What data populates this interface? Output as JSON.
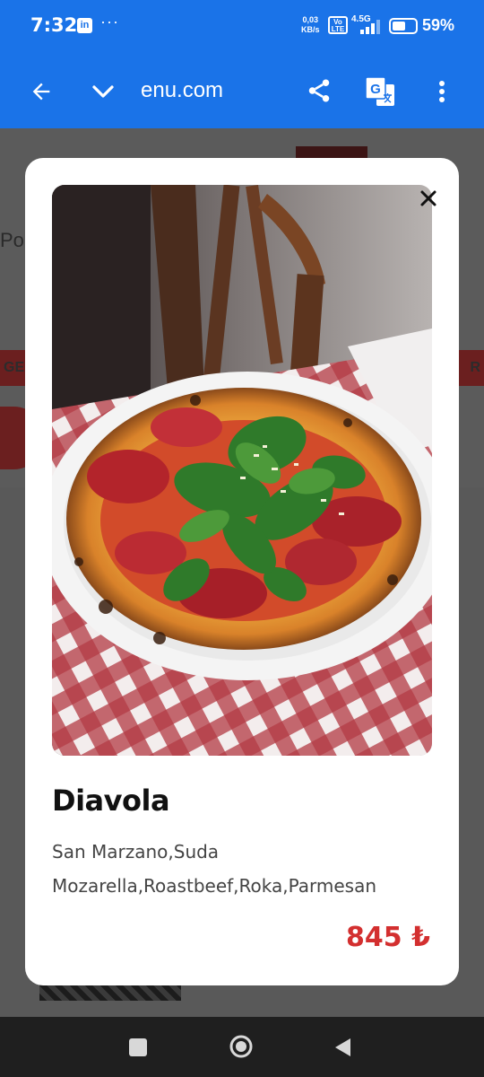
{
  "status_bar": {
    "time": "7:32",
    "linkedin_badge": "in",
    "more": "···",
    "data_rate_value": "0,03",
    "data_rate_unit": "KB/s",
    "volte_line1": "Vo",
    "volte_line2": "LTE",
    "network": "4.5G",
    "battery_percent": "59%",
    "battery_level": 0.59
  },
  "browser": {
    "url_fragment": "enu.com",
    "icons": [
      "back-arrow-icon",
      "chevron-down-icon",
      "share-icon",
      "translate-icon",
      "more-vert-icon"
    ]
  },
  "background_page": {
    "text_po": "Po",
    "band_left": "GE",
    "band_right": "R"
  },
  "product": {
    "name": "Diavola",
    "description": "San Marzano,Suda Mozarella,Roastbeef,Roka,Parmesan",
    "price": "845 ₺"
  },
  "colors": {
    "toolbar": "#1a73e8",
    "price": "#d32f2f"
  }
}
